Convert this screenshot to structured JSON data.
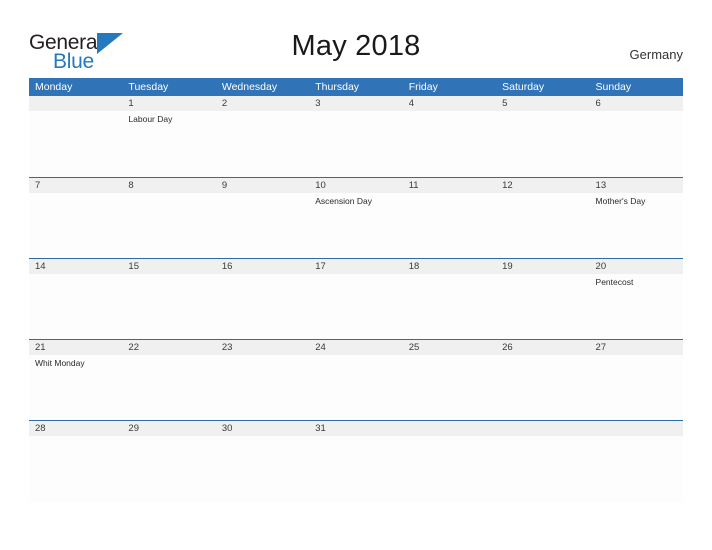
{
  "brand": {
    "word_one": "General",
    "word_two": "Blue",
    "triangle_icon": "triangle-logo-icon",
    "color_blue": "#2779bd",
    "color_dark": "#231f20"
  },
  "header": {
    "title": "May 2018",
    "country": "Germany"
  },
  "calendar": {
    "accent_color": "#3073b7",
    "separator_color": "#2e6da4",
    "datestrip_color": "#f0f0f0",
    "day_headers": [
      "Monday",
      "Tuesday",
      "Wednesday",
      "Thursday",
      "Friday",
      "Saturday",
      "Sunday"
    ],
    "weeks": [
      {
        "dates": [
          "",
          "1",
          "2",
          "3",
          "4",
          "5",
          "6"
        ],
        "events": [
          "",
          "Labour Day",
          "",
          "",
          "",
          "",
          ""
        ]
      },
      {
        "dates": [
          "7",
          "8",
          "9",
          "10",
          "11",
          "12",
          "13"
        ],
        "events": [
          "",
          "",
          "",
          "Ascension Day",
          "",
          "",
          "Mother's Day"
        ]
      },
      {
        "dates": [
          "14",
          "15",
          "16",
          "17",
          "18",
          "19",
          "20"
        ],
        "events": [
          "",
          "",
          "",
          "",
          "",
          "",
          "Pentecost"
        ]
      },
      {
        "dates": [
          "21",
          "22",
          "23",
          "24",
          "25",
          "26",
          "27"
        ],
        "events": [
          "Whit Monday",
          "",
          "",
          "",
          "",
          "",
          ""
        ]
      },
      {
        "dates": [
          "28",
          "29",
          "30",
          "31",
          "",
          "",
          ""
        ],
        "events": [
          "",
          "",
          "",
          "",
          "",
          "",
          ""
        ]
      }
    ]
  }
}
